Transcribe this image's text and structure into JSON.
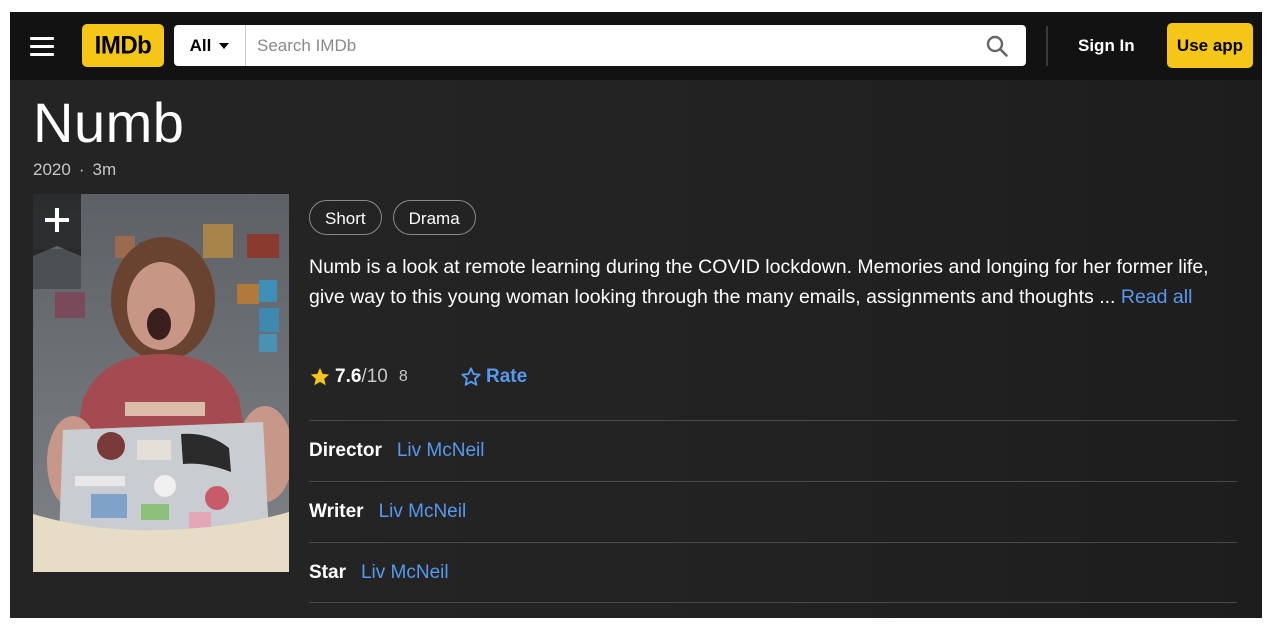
{
  "nav": {
    "logo": "IMDb",
    "search_category": "All",
    "search_placeholder": "Search IMDb",
    "sign_in": "Sign In",
    "use_app": "Use app"
  },
  "title": {
    "name": "Numb",
    "year": "2020",
    "separator": "·",
    "runtime": "3m"
  },
  "genres": [
    "Short",
    "Drama"
  ],
  "plot": {
    "text": "Numb is a look at remote learning during the COVID lockdown. Memories and longing for her former life, give way to this young woman looking through the many emails, assignments and thoughts ...",
    "read_all": "Read all"
  },
  "rating": {
    "value": "7.6",
    "out_of": "/10",
    "count": "8",
    "rate_label": "Rate"
  },
  "credits": [
    {
      "role": "Director",
      "name": "Liv McNeil"
    },
    {
      "role": "Writer",
      "name": "Liv McNeil"
    },
    {
      "role": "Star",
      "name": "Liv McNeil"
    }
  ],
  "colors": {
    "brand_yellow": "#f5c518",
    "link_blue": "#5799ef",
    "background": "#1f1f1f"
  }
}
